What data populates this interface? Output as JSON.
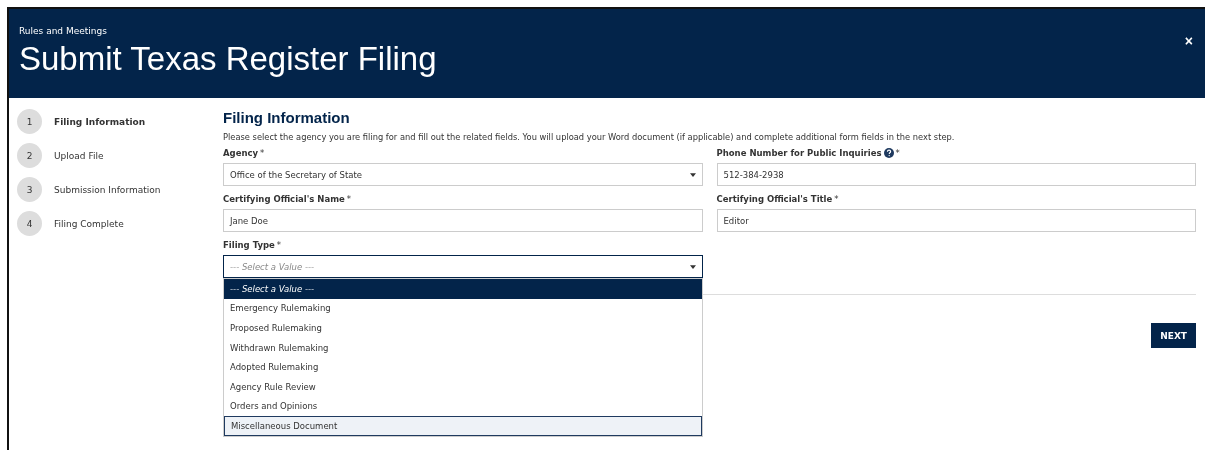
{
  "header": {
    "breadcrumb": "Rules and Meetings",
    "title": "Submit Texas Register Filing",
    "close": "×"
  },
  "steps": [
    {
      "number": "1",
      "label": "Filing Information",
      "active": true
    },
    {
      "number": "2",
      "label": "Upload File",
      "active": false
    },
    {
      "number": "3",
      "label": "Submission Information",
      "active": false
    },
    {
      "number": "4",
      "label": "Filing Complete",
      "active": false
    }
  ],
  "form": {
    "heading": "Filing Information",
    "description": "Please select the agency you are filing for and fill out the related fields. You will upload your Word document (if applicable) and complete additional form fields in the next step.",
    "fields": [
      {
        "kind": "select",
        "label": "Agency",
        "required": "*",
        "help": false,
        "value": "Office of the Secretary of State"
      },
      {
        "kind": "text",
        "label": "Phone Number for Public Inquiries",
        "required": "*",
        "help": true,
        "value": "512-384-2938"
      },
      {
        "kind": "text",
        "label": "Certifying Official's Name",
        "required": "*",
        "help": false,
        "value": "Jane Doe"
      },
      {
        "kind": "text",
        "label": "Certifying Official's Title",
        "required": "*",
        "help": false,
        "value": "Editor"
      },
      {
        "kind": "select",
        "label": "Filing Type",
        "required": "*",
        "help": false,
        "placeholder": "--- Select a Value ---",
        "focused": true
      }
    ],
    "dropdown": {
      "options": [
        {
          "label": "--- Select a Value ---",
          "placeholder": true,
          "selected": true,
          "hovered": false
        },
        {
          "label": "Emergency Rulemaking",
          "placeholder": false,
          "selected": false,
          "hovered": false
        },
        {
          "label": "Proposed Rulemaking",
          "placeholder": false,
          "selected": false,
          "hovered": false
        },
        {
          "label": "Withdrawn Rulemaking",
          "placeholder": false,
          "selected": false,
          "hovered": false
        },
        {
          "label": "Adopted Rulemaking",
          "placeholder": false,
          "selected": false,
          "hovered": false
        },
        {
          "label": "Agency Rule Review",
          "placeholder": false,
          "selected": false,
          "hovered": false
        },
        {
          "label": "Orders and Opinions",
          "placeholder": false,
          "selected": false,
          "hovered": false
        },
        {
          "label": "Miscellaneous Document",
          "placeholder": false,
          "selected": false,
          "hovered": true
        }
      ]
    },
    "next_button": "NEXT"
  }
}
